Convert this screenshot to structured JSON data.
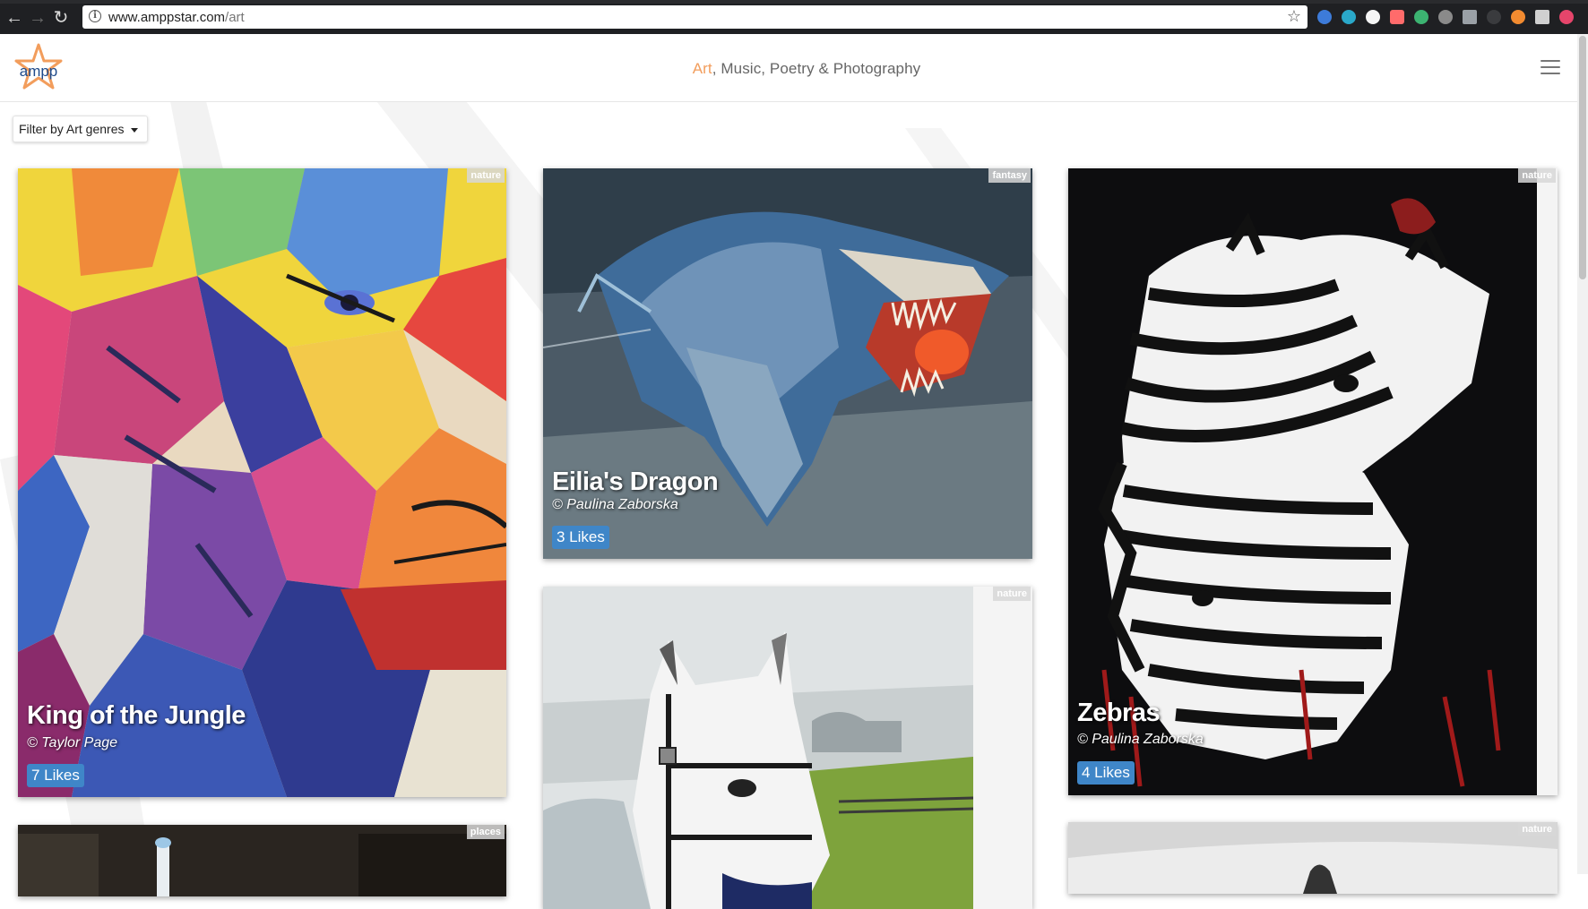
{
  "browser": {
    "url_host": "www.amppstar.com",
    "url_path": "/art"
  },
  "site": {
    "logo_text": "ampp",
    "tagline_accent": "Art",
    "tagline_rest": ", Music, Poetry & Photography",
    "filter_label": "Filter by Art genres"
  },
  "cards": [
    {
      "title": "King of the Jungle",
      "artist": "© Taylor Page",
      "likes": "7 Likes",
      "genre": "nature"
    },
    {
      "title": "Eilia's Dragon",
      "artist": "© Paulina Zaborska",
      "likes": "3 Likes",
      "genre": "fantasy"
    },
    {
      "title": "Zebras",
      "artist": "© Paulina Zaborska",
      "likes": "4 Likes",
      "genre": "nature"
    },
    {
      "title": "",
      "artist": "",
      "likes": "",
      "genre": "places"
    },
    {
      "title": "",
      "artist": "",
      "likes": "",
      "genre": "nature"
    },
    {
      "title": "",
      "artist": "",
      "likes": "",
      "genre": "nature"
    }
  ],
  "colors": {
    "accent": "#f29d5c",
    "likes_badge": "#3f86c8"
  }
}
